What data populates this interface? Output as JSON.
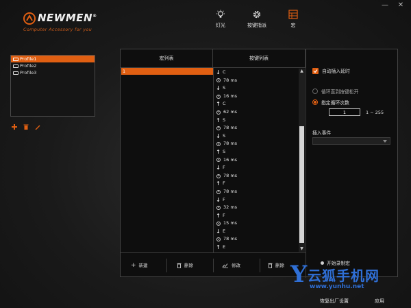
{
  "window": {
    "minimize_glyph": "—",
    "close_glyph": "✕"
  },
  "logo": {
    "name": "NEWMEN",
    "trademark": "®",
    "tagline": "Computer Accessory for you"
  },
  "nav": [
    {
      "label": "灯光",
      "icon": "bulb-icon"
    },
    {
      "label": "按键指派",
      "icon": "gear-icon"
    },
    {
      "label": "宏",
      "icon": "macro-grid-icon"
    }
  ],
  "profiles": {
    "items": [
      "Profile1",
      "Profile2",
      "Profile3"
    ],
    "selected": "Profile1"
  },
  "macro": {
    "col_macro_list": "宏列表",
    "col_key_list": "按键列表",
    "macro_items": [
      "1"
    ],
    "key_events": [
      {
        "type": "down",
        "text": "C"
      },
      {
        "type": "delay",
        "text": "78 ms"
      },
      {
        "type": "down",
        "text": "S"
      },
      {
        "type": "delay",
        "text": "16 ms"
      },
      {
        "type": "up",
        "text": "C"
      },
      {
        "type": "delay",
        "text": "62 ms"
      },
      {
        "type": "up",
        "text": "S"
      },
      {
        "type": "delay",
        "text": "78 ms"
      },
      {
        "type": "down",
        "text": "S"
      },
      {
        "type": "delay",
        "text": "78 ms"
      },
      {
        "type": "up",
        "text": "S"
      },
      {
        "type": "delay",
        "text": "16 ms"
      },
      {
        "type": "down",
        "text": "F"
      },
      {
        "type": "delay",
        "text": "78 ms"
      },
      {
        "type": "up",
        "text": "F"
      },
      {
        "type": "delay",
        "text": "78 ms"
      },
      {
        "type": "down",
        "text": "F"
      },
      {
        "type": "delay",
        "text": "32 ms"
      },
      {
        "type": "up",
        "text": "F"
      },
      {
        "type": "delay",
        "text": "15 ms"
      },
      {
        "type": "down",
        "text": "E"
      },
      {
        "type": "delay",
        "text": "78 ms"
      },
      {
        "type": "up",
        "text": "E"
      }
    ],
    "btn_new": "新建",
    "btn_delete": "删除",
    "btn_edit": "修改",
    "btn_delete_key": "删除"
  },
  "settings": {
    "auto_insert_delay": "自动插入延时",
    "loop_until_release": "循环直到按键松开",
    "specified_loop_count": "指定循环次数",
    "loop_count_value": "1",
    "loop_range": "1 ~ 255",
    "insert_event_label": "插入事件",
    "insert_event_value": "",
    "record_label": "开始录制宏"
  },
  "footer": {
    "restore_defaults": "恢复出厂设置",
    "apply": "应用"
  },
  "watermark": {
    "letter": "Y",
    "cn": "云狐手机网",
    "url": "www.yunhu.net"
  },
  "colors": {
    "accent": "#e05f12",
    "watermark": "#2f6fd6"
  }
}
